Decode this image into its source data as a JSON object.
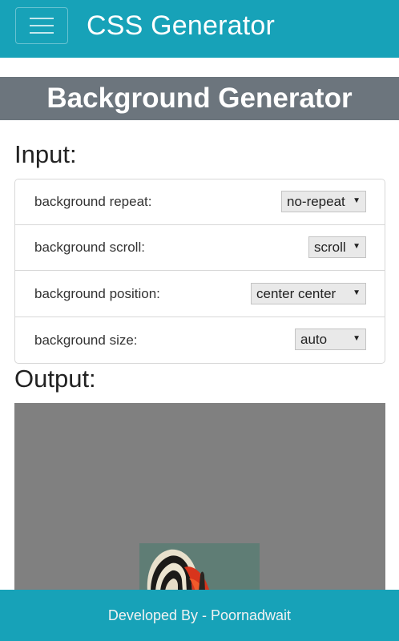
{
  "app": {
    "title": "CSS Generator"
  },
  "banner": {
    "title": "Background Generator"
  },
  "input": {
    "heading": "Input:",
    "rows": [
      {
        "label": "background repeat:",
        "value": "no-repeat"
      },
      {
        "label": "background scroll:",
        "value": "scroll"
      },
      {
        "label": "background position:",
        "value": "center center"
      },
      {
        "label": "background size:",
        "value": "auto"
      }
    ]
  },
  "output": {
    "heading": "Output:"
  },
  "footer": {
    "text": "Developed By - Poornadwait"
  },
  "colors": {
    "primary": "#17a2b8",
    "banner": "#6c757d",
    "preview": "#808080"
  },
  "icons": {
    "menu": "hamburger-menu-icon",
    "dropdown": "dropdown-caret-icon"
  }
}
